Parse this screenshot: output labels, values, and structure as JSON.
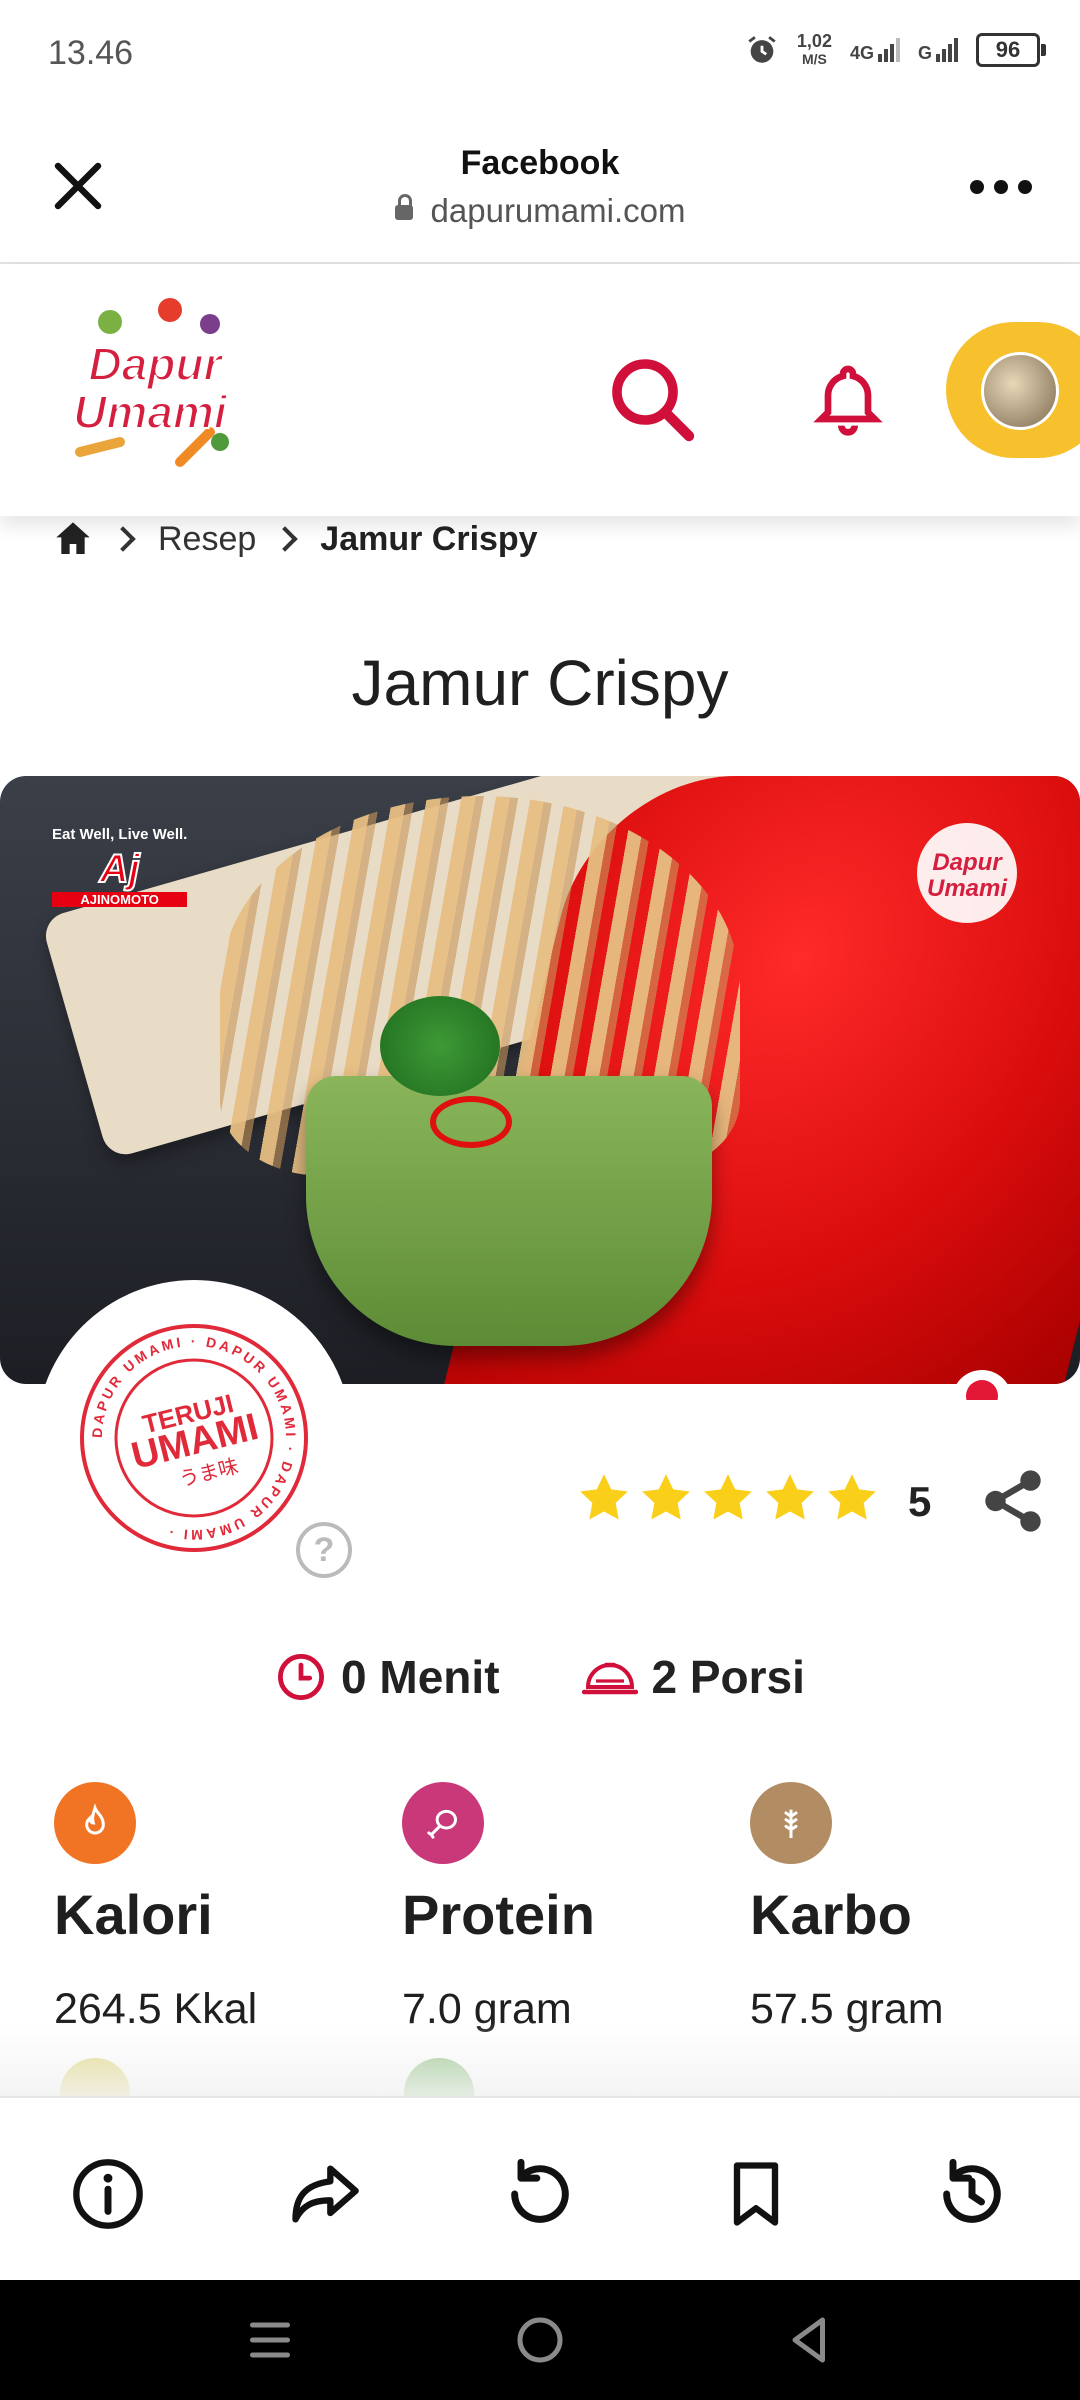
{
  "status_bar": {
    "time": "13.46",
    "net_speed_value": "1,02",
    "net_speed_unit": "M/S",
    "net_1": "4G",
    "net_2": "G",
    "battery": "96"
  },
  "browser": {
    "title": "Facebook",
    "url": "dapurumami.com"
  },
  "site": {
    "logo_text_1": "Dapur",
    "logo_text_2": "Umami"
  },
  "breadcrumb": {
    "item_1": "Resep",
    "current": "Jamur Crispy"
  },
  "recipe": {
    "title": "Jamur Crispy",
    "image_brand_tagline": "Eat Well, Live Well.",
    "image_brand_mark": "Aj",
    "image_brand_name": "AJINOMOTO",
    "stamp_line_1": "TERUJI",
    "stamp_line_2": "UMAMI",
    "stamp_line_3": "うま味",
    "stamp_ring": "DAPUR UMAMI · DAPUR UMAMI · DAPUR UMAMI ·",
    "help": "?",
    "rating": "5",
    "rating_stars": 5,
    "time": "0 Menit",
    "portions": "2 Porsi"
  },
  "nutrition": [
    {
      "name": "Kalori",
      "value": "264.5 Kkal",
      "color": "#f07423"
    },
    {
      "name": "Protein",
      "value": "7.0 gram",
      "color": "#c93879"
    },
    {
      "name": "Karbo",
      "value": "57.5 gram",
      "color": "#b28c62"
    }
  ],
  "colors": {
    "brand_red": "#d0103a",
    "brand_yellow": "#f7c12d",
    "star": "#f9cf1a"
  },
  "toolbar": {
    "icons": [
      "info-icon",
      "share-forward-icon",
      "reload-icon",
      "bookmark-icon",
      "history-icon"
    ]
  },
  "navbar": {
    "icons": [
      "menu-icon",
      "home-icon",
      "back-icon"
    ]
  }
}
